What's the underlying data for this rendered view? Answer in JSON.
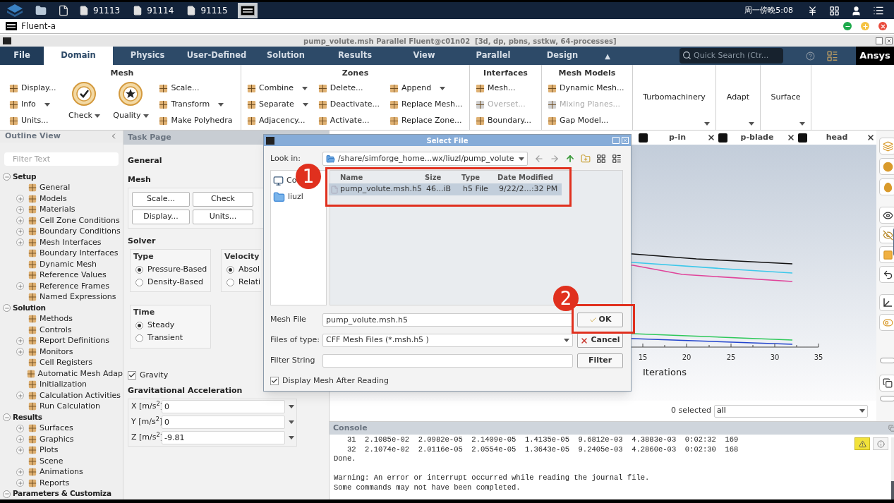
{
  "taskbar": {
    "windows": [
      {
        "label": "91113",
        "selected": false
      },
      {
        "label": "91114",
        "selected": false
      },
      {
        "label": "91115",
        "selected": false
      },
      {
        "selected": true
      }
    ],
    "clock": "周一傍晚5:08"
  },
  "app_bar": {
    "title": "Fluent-a"
  },
  "window": {
    "title": "pump_volute.msh Parallel Fluent@c01n02  [3d, dp, pbns, sstkw, 64-processes]"
  },
  "ribbon_tabs": [
    {
      "label": "File",
      "selected": false
    },
    {
      "label": "Domain",
      "selected": true
    },
    {
      "label": "Physics",
      "selected": false
    },
    {
      "label": "User-Defined",
      "selected": false
    },
    {
      "label": "Solution",
      "selected": false
    },
    {
      "label": "Results",
      "selected": false
    },
    {
      "label": "View",
      "selected": false
    },
    {
      "label": "Parallel",
      "selected": false
    },
    {
      "label": "Design",
      "selected": false
    }
  ],
  "collapse_ribbon": "▲",
  "quick_search": {
    "placeholder": "Quick Search (Ctr..."
  },
  "brand": "Ansys",
  "ribbon": {
    "groups": [
      {
        "title": "Mesh",
        "kind": "panel",
        "columns": [
          {
            "kind": "list",
            "items": [
              {
                "label": "Display...",
                "dropdown": false,
                "disabled": false
              },
              {
                "label": "Info",
                "dropdown": true,
                "disabled": false
              },
              {
                "label": "Units...",
                "dropdown": false,
                "disabled": false
              }
            ]
          },
          {
            "kind": "large",
            "label": "Check",
            "dropdown": true
          },
          {
            "kind": "large",
            "label": "Quality",
            "dropdown": true
          },
          {
            "kind": "list",
            "items": [
              {
                "label": "Scale...",
                "dropdown": false,
                "disabled": false
              },
              {
                "label": "Transform",
                "dropdown": true,
                "disabled": false
              },
              {
                "label": "Make Polyhedra",
                "dropdown": false,
                "disabled": false
              }
            ]
          }
        ]
      },
      {
        "title": "Zones",
        "kind": "panel",
        "columns": [
          {
            "kind": "list",
            "items": [
              {
                "label": "Combine",
                "dropdown": true,
                "disabled": false
              },
              {
                "label": "Separate",
                "dropdown": true,
                "disabled": false
              },
              {
                "label": "Adjacency...",
                "dropdown": false,
                "disabled": false
              }
            ]
          },
          {
            "kind": "list",
            "items": [
              {
                "label": "Delete...",
                "dropdown": false,
                "disabled": false
              },
              {
                "label": "Deactivate...",
                "dropdown": false,
                "disabled": false
              },
              {
                "label": "Activate...",
                "dropdown": false,
                "disabled": false
              }
            ]
          },
          {
            "kind": "list",
            "items": [
              {
                "label": "Append",
                "dropdown": true,
                "disabled": false
              },
              {
                "label": "Replace Mesh...",
                "dropdown": false,
                "disabled": false
              },
              {
                "label": "Replace Zone...",
                "dropdown": false,
                "disabled": false
              }
            ]
          }
        ]
      },
      {
        "title": "Interfaces",
        "kind": "panel",
        "columns": [
          {
            "kind": "list",
            "items": [
              {
                "label": "Mesh...",
                "dropdown": false,
                "disabled": false
              },
              {
                "label": "Overset...",
                "dropdown": false,
                "disabled": true
              },
              {
                "label": "Boundary...",
                "dropdown": false,
                "disabled": false
              }
            ]
          }
        ]
      },
      {
        "title": "Mesh Models",
        "kind": "panel",
        "columns": [
          {
            "kind": "list",
            "items": [
              {
                "label": "Dynamic Mesh...",
                "dropdown": false,
                "disabled": false
              },
              {
                "label": "Mixing Planes...",
                "dropdown": false,
                "disabled": true
              },
              {
                "label": "Gap Model...",
                "dropdown": false,
                "disabled": false
              }
            ]
          }
        ]
      },
      {
        "title": "Turbomachinery",
        "kind": "menu"
      },
      {
        "title": "Adapt",
        "kind": "menu"
      },
      {
        "title": "Surface",
        "kind": "menu"
      }
    ]
  },
  "outline": {
    "title": "Outline View",
    "filter_placeholder": "Filter Text",
    "tree": [
      {
        "label": "Setup",
        "expanded": true,
        "children": [
          {
            "label": "General",
            "kind": "leaf"
          },
          {
            "label": "Models",
            "kind": "branch"
          },
          {
            "label": "Materials",
            "kind": "branch"
          },
          {
            "label": "Cell Zone Conditions",
            "kind": "branch"
          },
          {
            "label": "Boundary Conditions",
            "kind": "branch"
          },
          {
            "label": "Mesh Interfaces",
            "kind": "branch"
          },
          {
            "label": "Boundary Interfaces",
            "kind": "leaf"
          },
          {
            "label": "Dynamic Mesh",
            "kind": "leaf"
          },
          {
            "label": "Reference Values",
            "kind": "leaf"
          },
          {
            "label": "Reference Frames",
            "kind": "branch"
          },
          {
            "label": "Named Expressions",
            "kind": "leaf"
          }
        ]
      },
      {
        "label": "Solution",
        "expanded": true,
        "children": [
          {
            "label": "Methods",
            "kind": "leaf"
          },
          {
            "label": "Controls",
            "kind": "leaf"
          },
          {
            "label": "Report Definitions",
            "kind": "branch"
          },
          {
            "label": "Monitors",
            "kind": "branch"
          },
          {
            "label": "Cell Registers",
            "kind": "leaf"
          },
          {
            "label": "Automatic Mesh Adap",
            "kind": "leaf"
          },
          {
            "label": "Initialization",
            "kind": "leaf"
          },
          {
            "label": "Calculation Activities",
            "kind": "branch"
          },
          {
            "label": "Run Calculation",
            "kind": "leaf"
          }
        ]
      },
      {
        "label": "Results",
        "expanded": true,
        "children": [
          {
            "label": "Surfaces",
            "kind": "branch"
          },
          {
            "label": "Graphics",
            "kind": "branch"
          },
          {
            "label": "Plots",
            "kind": "branch"
          },
          {
            "label": "Scene",
            "kind": "leaf"
          },
          {
            "label": "Animations",
            "kind": "branch"
          },
          {
            "label": "Reports",
            "kind": "branch"
          }
        ]
      },
      {
        "label": "Parameters & Customiza",
        "expanded": true
      }
    ]
  },
  "task_page": {
    "title": "Task Page",
    "heading": "General",
    "mesh": {
      "title": "Mesh",
      "buttons": [
        "Scale...",
        "Check",
        "Display...",
        "Units..."
      ]
    },
    "solver": {
      "title": "Solver",
      "type": {
        "title": "Type",
        "options": [
          {
            "label": "Pressure-Based",
            "selected": true
          },
          {
            "label": "Density-Based",
            "selected": false
          }
        ]
      },
      "velocity": {
        "title": "Velocity",
        "options": [
          {
            "label": "Absol",
            "selected": true
          },
          {
            "label": "Relati",
            "selected": false
          }
        ]
      },
      "time": {
        "title": "Time",
        "options": [
          {
            "label": "Steady",
            "selected": true
          },
          {
            "label": "Transient",
            "selected": false
          }
        ]
      }
    },
    "gravity": {
      "label": "Gravity",
      "checked": true
    },
    "acceleration": {
      "title": "Gravitational Acceleration",
      "fields": [
        {
          "label": "X [m/s$^{2}$]",
          "value": "0"
        },
        {
          "label": "Y [m/s$^{2}$]",
          "value": "0"
        },
        {
          "label": "Z [m/s$^{2}$]",
          "value": "-9.81"
        }
      ]
    }
  },
  "graphics": {
    "tabs": [
      {
        "label": "p-in",
        "selected": false
      },
      {
        "label": "p-blade",
        "selected": false
      },
      {
        "label": "head",
        "selected": false
      }
    ],
    "plot": {
      "x_ticks": [
        "15",
        "20",
        "25",
        "30",
        "35"
      ],
      "x_label": "Iterations"
    },
    "selection": {
      "count": "0 selected",
      "filter": "all"
    }
  },
  "console": {
    "title": "Console",
    "blocks": [
      [
        "   31  2.1085e-02  2.0982e-05  2.1409e-05  1.4135e-05  9.6812e-03  4.3883e-03  0:02:32  169",
        "   32  2.1074e-02  2.0116e-05  2.0554e-05  1.3643e-05  9.2405e-03  4.2860e-03  0:02:30  168",
        "Done."
      ],
      [
        "Warning: An error or interrupt occurred while reading the journal file.",
        "Some commands may not have been completed."
      ]
    ]
  },
  "dialog": {
    "title": "Select File",
    "look_in": {
      "label": "Look in:",
      "value": "/share/simforge_home...wx/liuzl/pump_volute"
    },
    "places": [
      {
        "label": "Co",
        "kind": "computer"
      },
      {
        "label": "liuzl",
        "kind": "folder"
      }
    ],
    "columns": [
      "Name",
      "Size",
      "Type",
      "Date Modified"
    ],
    "rows": [
      {
        "cells": [
          "pump_volute.msh.h5",
          "46...iB",
          "h5 File",
          "9/22/2...:32 PM"
        ],
        "selected": true
      }
    ],
    "mesh_file": {
      "label": "Mesh File",
      "value": "pump_volute.msh.h5"
    },
    "file_type": {
      "label": "Files of type:",
      "value": "CFF Mesh Files (*.msh.h5 )"
    },
    "filter": {
      "label": "Filter String"
    },
    "buttons": [
      {
        "label": "OK",
        "kind": "ok"
      },
      {
        "label": "Cancel",
        "kind": "cancel"
      },
      {
        "label": "Filter",
        "kind": "filter"
      }
    ],
    "display_mesh": {
      "label": "Display Mesh After Reading",
      "checked": true
    }
  },
  "annotations": [
    {
      "label": "1"
    },
    {
      "label": "2"
    }
  ]
}
